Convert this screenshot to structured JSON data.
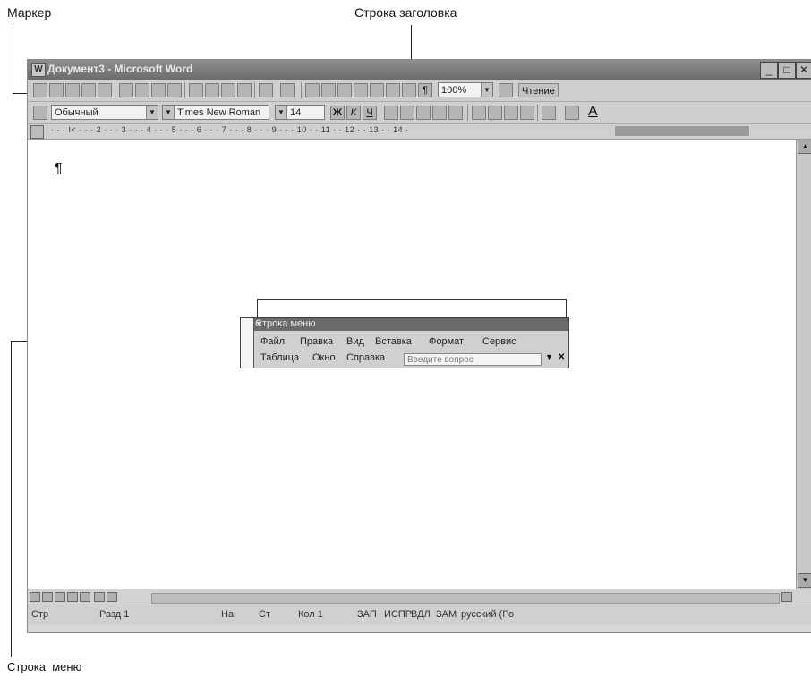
{
  "callouts": {
    "marker": "Маркер",
    "title_bar": "Строка заголовка",
    "menu_bar": "Строка  меню"
  },
  "window": {
    "title": "Документ3 - Microsoft Word"
  },
  "toolbar_standard": {
    "zoom": "100%",
    "read_button": "Чтение"
  },
  "toolbar_format": {
    "style": "Обычный",
    "font": "Times New Roman",
    "size": "14",
    "font_color_letter": "A"
  },
  "ruler": {
    "numbers": "· · · I< · · · 2 · · · 3 · · · 4 · · · 5 · · · 6 · · · 7 · · · 8 · · · 9 · · · 10 · · 11 · · 12 · · 13 · · 14 ·"
  },
  "document": {
    "paragraph_mark": "¶"
  },
  "menu_toolbar": {
    "title": "Строка меню",
    "row1": [
      "Файл",
      "Правка",
      "Вид",
      "Вставка",
      "Формат",
      "Сервис"
    ],
    "row2": [
      "Таблица",
      "Окно",
      "Справка"
    ],
    "ask_placeholder": "Введите вопрос"
  },
  "status_bar": {
    "page": "Стр",
    "section": "Разд 1",
    "at": "На",
    "line": "Ст",
    "column": "Кол 1",
    "rec": "ЗАП",
    "ispr": "ИСПР",
    "vdl": "ВДЛ",
    "zam": "ЗАМ",
    "language": "русский (Ро"
  },
  "icons": [
    "word-app-icon",
    "minimize-icon",
    "maximize-icon",
    "close-icon",
    "dropdown-arrow-icon"
  ]
}
